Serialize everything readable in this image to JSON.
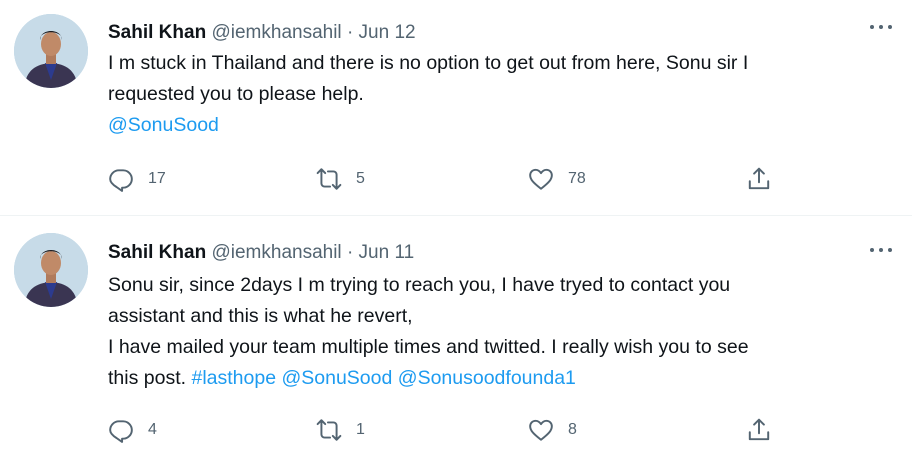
{
  "tweets": [
    {
      "author_name": "Sahil Khan",
      "handle": "@iemkhansahil",
      "separator": "·",
      "date": "Jun 12",
      "text_lines": [
        "I m stuck in Thailand and there is no option to get out from here, Sonu sir I",
        "requested you to please help."
      ],
      "mention": "@SonuSood",
      "replies": "17",
      "retweets": "5",
      "likes": "78"
    },
    {
      "author_name": "Sahil Khan",
      "handle": "@iemkhansahil",
      "separator": "·",
      "date": "Jun 11",
      "text_lines": [
        "Sonu sir, since 2days I m trying to reach you, I have tryed to contact you",
        "assistant and this is what he revert,",
        "I have mailed your team multiple times and twitted. I really wish you to see"
      ],
      "last_line_prefix": "this post. ",
      "hashtag": "#lasthope",
      "mention_1": "@SonuSood",
      "mention_2": "@Sonusoodfounda1",
      "replies": "4",
      "retweets": "1",
      "likes": "8"
    }
  ],
  "icons": {
    "reply": "reply-icon",
    "retweet": "retweet-icon",
    "like": "heart-icon",
    "share": "share-icon",
    "more": "more-icon"
  },
  "colors": {
    "link": "#1d9bf0",
    "muted": "#536471",
    "text": "#0f1419"
  }
}
